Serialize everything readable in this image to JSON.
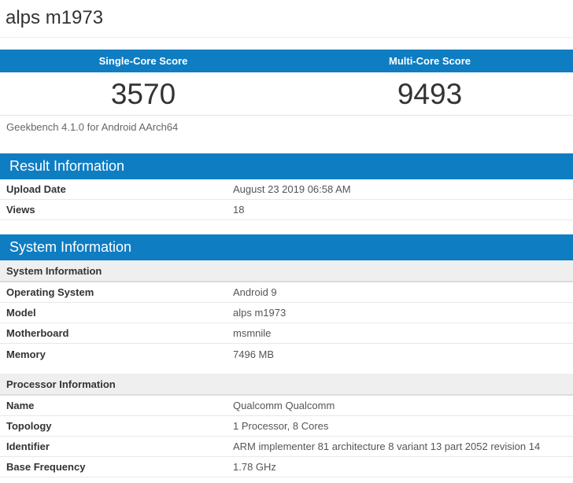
{
  "page": {
    "title": "alps m1973"
  },
  "scores": {
    "single": {
      "label": "Single-Core Score",
      "value": "3570"
    },
    "multi": {
      "label": "Multi-Core Score",
      "value": "9493"
    },
    "platform_note": "Geekbench 4.1.0 for Android AArch64"
  },
  "result_information": {
    "heading": "Result Information",
    "rows": [
      {
        "label": "Upload Date",
        "value": "August 23 2019 06:58 AM"
      },
      {
        "label": "Views",
        "value": "18"
      }
    ]
  },
  "system_information": {
    "heading": "System Information",
    "groups": [
      {
        "subheading": "System Information",
        "rows": [
          {
            "label": "Operating System",
            "value": "Android 9"
          },
          {
            "label": "Model",
            "value": "alps m1973"
          },
          {
            "label": "Motherboard",
            "value": "msmnile"
          },
          {
            "label": "Memory",
            "value": "7496 MB"
          }
        ]
      },
      {
        "subheading": "Processor Information",
        "rows": [
          {
            "label": "Name",
            "value": "Qualcomm Qualcomm"
          },
          {
            "label": "Topology",
            "value": "1 Processor, 8 Cores"
          },
          {
            "label": "Identifier",
            "value": "ARM implementer 81 architecture 8 variant 13 part 2052 revision 14"
          },
          {
            "label": "Base Frequency",
            "value": "1.78 GHz"
          }
        ]
      }
    ]
  },
  "colors": {
    "accent_blue": "#0f7dc2",
    "subheader_gray": "#efefef"
  }
}
